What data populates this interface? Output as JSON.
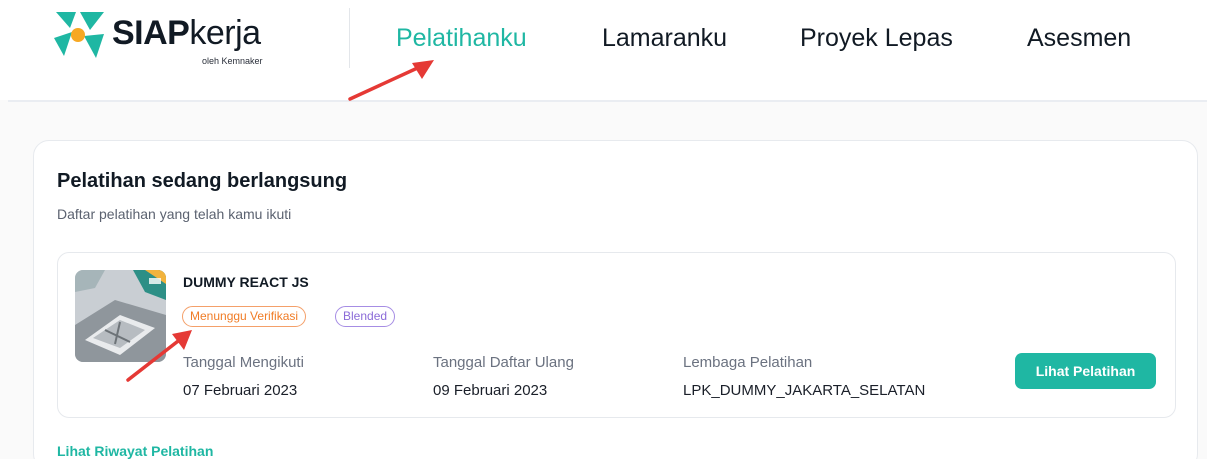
{
  "header": {
    "logo_bold": "SIAP",
    "logo_light": "kerja",
    "logo_sub": "oleh Kemnaker",
    "nav": [
      {
        "label": "Pelatihanku",
        "active": true
      },
      {
        "label": "Lamaranku",
        "active": false
      },
      {
        "label": "Proyek Lepas",
        "active": false
      },
      {
        "label": "Asesmen",
        "active": false
      }
    ]
  },
  "section": {
    "title": "Pelatihan sedang berlangsung",
    "subtitle": "Daftar pelatihan yang telah kamu ikuti"
  },
  "training": {
    "title": "DUMMY REACT JS",
    "badges": [
      "Menunggu Verifikasi",
      "Blended"
    ],
    "fields": [
      {
        "label": "Tanggal Mengikuti",
        "value": "07 Februari 2023"
      },
      {
        "label": "Tanggal Daftar Ulang",
        "value": "09 Februari 2023"
      },
      {
        "label": "Lembaga Pelatihan",
        "value": "LPK_DUMMY_JAKARTA_SELATAN"
      }
    ],
    "button": "Lihat Pelatihan"
  },
  "history_link": "Lihat Riwayat Pelatihan",
  "colors": {
    "accent": "#1fb7a3",
    "annotation": "#e53935",
    "badge_orange": "#f07c26",
    "badge_purple": "#8b6bd8"
  }
}
